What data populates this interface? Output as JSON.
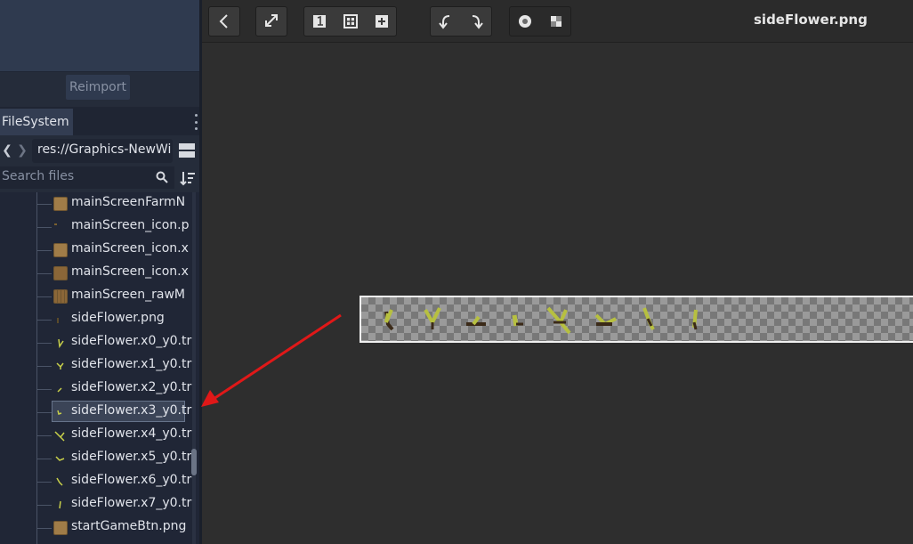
{
  "dock": {
    "reimport_label": "Reimport",
    "filesystem_tab": "FileSystem",
    "path_value": "res://Graphics-NewWi",
    "search_placeholder": "Search files"
  },
  "tree": {
    "items": [
      {
        "label": "mainScreenFarmN",
        "icon": "image-file-icon"
      },
      {
        "label": "mainScreen_icon.p",
        "icon": "image-file-icon"
      },
      {
        "label": "mainScreen_icon.x",
        "icon": "resource-file-icon"
      },
      {
        "label": "mainScreen_icon.x",
        "icon": "resource-file-icon"
      },
      {
        "label": "mainScreen_rawM",
        "icon": "resource-file-icon"
      },
      {
        "label": "sideFlower.png",
        "icon": "image-file-icon"
      },
      {
        "label": "sideFlower.x0_y0.tr",
        "icon": "texture-file-icon"
      },
      {
        "label": "sideFlower.x1_y0.tr",
        "icon": "texture-file-icon"
      },
      {
        "label": "sideFlower.x2_y0.tr",
        "icon": "texture-file-icon"
      },
      {
        "label": "sideFlower.x3_y0.tr",
        "icon": "texture-file-icon",
        "selected": true
      },
      {
        "label": "sideFlower.x4_y0.tr",
        "icon": "texture-file-icon"
      },
      {
        "label": "sideFlower.x5_y0.tr",
        "icon": "texture-file-icon"
      },
      {
        "label": "sideFlower.x6_y0.tr",
        "icon": "texture-file-icon"
      },
      {
        "label": "sideFlower.x7_y0.tr",
        "icon": "texture-file-icon"
      },
      {
        "label": "startGameBtn.png",
        "icon": "resource-file-icon"
      }
    ]
  },
  "toolbar": {
    "filename": "sideFlower.png",
    "buttons": [
      "back-icon",
      "zoom-fit-icon",
      "zoom-1-icon",
      "zoom-region-icon",
      "zoom-plus-icon",
      "undo-icon",
      "redo-icon",
      "show-region-icon",
      "checker-icon"
    ]
  },
  "colors": {
    "annotation_arrow": "#e01818",
    "leaf": "#b7c040",
    "stem": "#3b2a18"
  }
}
